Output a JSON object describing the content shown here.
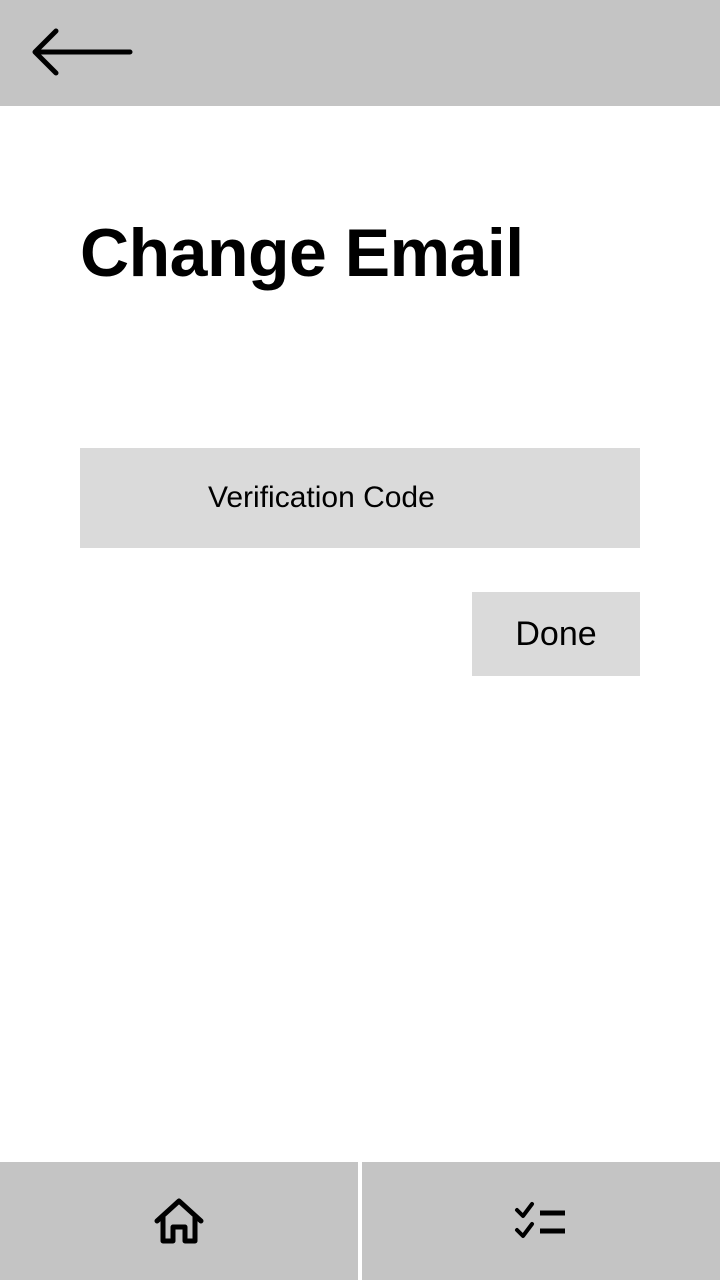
{
  "header": {
    "back_icon": "arrow-left-icon"
  },
  "page": {
    "title": "Change Email"
  },
  "form": {
    "verification_code_placeholder": "Verification Code",
    "verification_code_value": "",
    "done_label": "Done"
  },
  "bottom_nav": {
    "items": [
      {
        "icon": "home-icon"
      },
      {
        "icon": "checklist-icon"
      }
    ]
  },
  "colors": {
    "bar_background": "#c4c4c4",
    "control_background": "#dadada",
    "page_background": "#ffffff",
    "text": "#000000"
  }
}
